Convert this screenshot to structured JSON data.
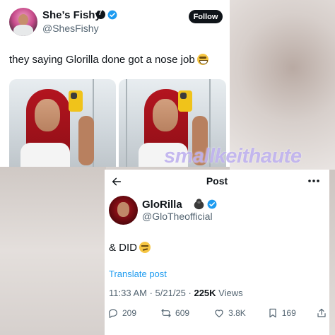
{
  "watermark": "smallkeithaute",
  "top_tweet": {
    "display_name": "She’s Fishy",
    "handle": "@ShesFishy",
    "follow_label": "Follow",
    "text": "they saying Glorilla done got a nose job",
    "emoji": "grimacing-face-emoji",
    "photo_count": 2
  },
  "post": {
    "header_title": "Post",
    "display_name": "GloRilla",
    "name_emoji": "gorilla-emoji",
    "handle": "@GloTheofficial",
    "text": "& DID",
    "text_emoji": "unamused-face-emoji",
    "translate_label": "Translate post",
    "time": "11:33 AM",
    "date": "5/21/25",
    "views_count": "225K",
    "views_label": "Views",
    "actions": {
      "replies": "209",
      "reposts": "609",
      "likes": "3.8K",
      "bookmarks": "169"
    }
  },
  "colors": {
    "accent": "#1d9bf0",
    "text_primary": "#0f1419",
    "text_secondary": "#536471",
    "watermark": "#b7a8ec"
  }
}
